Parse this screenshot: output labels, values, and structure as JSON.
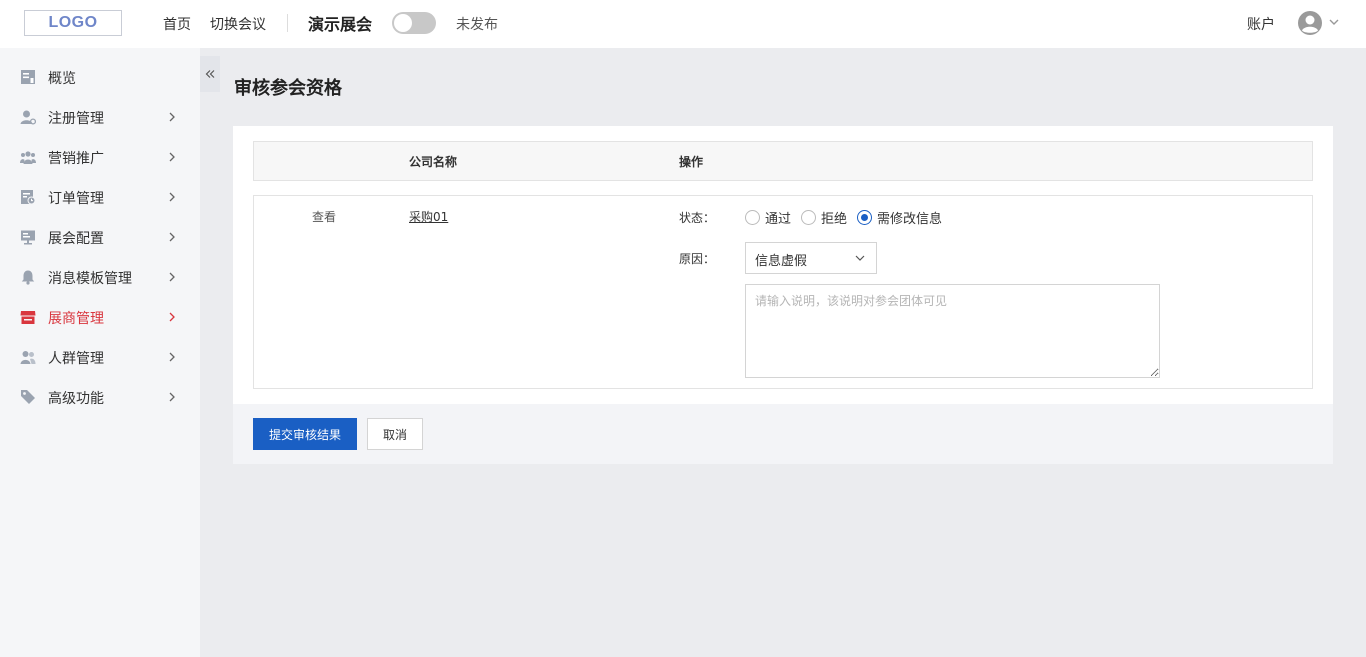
{
  "header": {
    "logo_text": "LOGO",
    "nav": [
      {
        "label": "首页"
      },
      {
        "label": "切换会议"
      }
    ],
    "expo_title": "演示展会",
    "publish_status": "未发布",
    "account_label": "账户"
  },
  "sidebar": {
    "items": [
      {
        "label": "概览",
        "icon": "overview-icon"
      },
      {
        "label": "注册管理",
        "icon": "user-register-icon"
      },
      {
        "label": "营销推广",
        "icon": "marketing-icon"
      },
      {
        "label": "订单管理",
        "icon": "order-icon"
      },
      {
        "label": "展会配置",
        "icon": "config-icon"
      },
      {
        "label": "消息模板管理",
        "icon": "bell-icon"
      },
      {
        "label": "展商管理",
        "icon": "store-icon"
      },
      {
        "label": "人群管理",
        "icon": "people-icon"
      },
      {
        "label": "高级功能",
        "icon": "tag-icon"
      }
    ],
    "active_color": "#d9363e"
  },
  "page": {
    "title": "审核参会资格",
    "table": {
      "headers": [
        "公司名称",
        "操作"
      ],
      "row": {
        "view_label": "查看",
        "company": "采购01",
        "status_label": "状态：",
        "status_options": [
          "通过",
          "拒绝",
          "需修改信息"
        ],
        "status_selected": "需修改信息",
        "reason_label": "原因：",
        "reason_value": "信息虚假",
        "note_placeholder": "请输入说明，该说明对参会团体可见"
      }
    },
    "buttons": {
      "submit": "提交审核结果",
      "cancel": "取消"
    }
  },
  "colors": {
    "primary": "#1a5fc4",
    "background": "#ebecef"
  }
}
